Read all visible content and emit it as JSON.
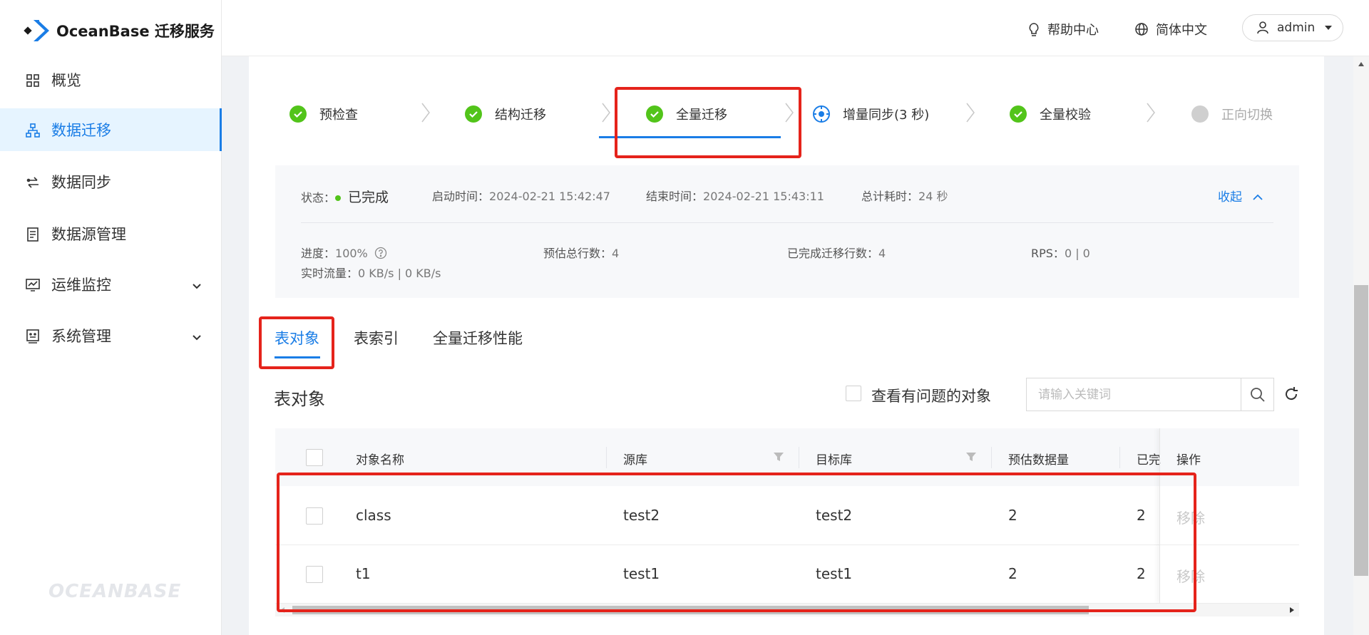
{
  "app": {
    "brand": "OceanBase 迁移服务",
    "footer_logo": "OCEANBASE"
  },
  "colors": {
    "accent": "#1a7de6",
    "success": "#52c41a",
    "highlight": "#e5231b"
  },
  "sidebar": {
    "items": [
      {
        "label": "概览",
        "icon": "grid-icon"
      },
      {
        "label": "数据迁移",
        "icon": "sitemap-icon",
        "active": true
      },
      {
        "label": "数据同步",
        "icon": "sync-icon"
      },
      {
        "label": "数据源管理",
        "icon": "database-icon"
      },
      {
        "label": "运维监控",
        "icon": "monitor-icon",
        "expandable": true
      },
      {
        "label": "系统管理",
        "icon": "system-icon",
        "expandable": true
      }
    ]
  },
  "topbar": {
    "help": "帮助中心",
    "language": "简体中文",
    "user": "admin"
  },
  "steps": [
    {
      "label": "预检查",
      "state": "done"
    },
    {
      "label": "结构迁移",
      "state": "done"
    },
    {
      "label": "全量迁移",
      "state": "done",
      "selected": true
    },
    {
      "label": "增量同步(3 秒)",
      "state": "running"
    },
    {
      "label": "全量校验",
      "state": "done"
    },
    {
      "label": "正向切换",
      "state": "pending"
    }
  ],
  "status": {
    "state_label": "状态：",
    "state_value": "已完成",
    "start_label": "启动时间：",
    "start_value": "2024-02-21 15:42:47",
    "end_label": "结束时间：",
    "end_value": "2024-02-21 15:43:11",
    "duration_label": "总计耗时：",
    "duration_value": "24 秒",
    "collapse": "收起",
    "progress_label": "进度：",
    "progress_value": "100%",
    "est_rows_label": "预估总行数：",
    "est_rows_value": "4",
    "done_rows_label": "已完成迁移行数：",
    "done_rows_value": "4",
    "rps_label": "RPS：",
    "rps_value": "0 | 0",
    "traffic_label": "实时流量：",
    "traffic_value": "0 KB/s | 0 KB/s"
  },
  "tabs": [
    "表对象",
    "表索引",
    "全量迁移性能"
  ],
  "section": {
    "title": "表对象",
    "issue_filter": "查看有问题的对象",
    "search_placeholder": "请输入关键词"
  },
  "table": {
    "headers": [
      "对象名称",
      "源库",
      "目标库",
      "预估数据量",
      "已完",
      "操作"
    ],
    "rows": [
      {
        "name": "class",
        "source": "test2",
        "target": "test2",
        "estimated": "2",
        "done": "2",
        "action": "移除"
      },
      {
        "name": "t1",
        "source": "test1",
        "target": "test1",
        "estimated": "2",
        "done": "2",
        "action": "移除"
      }
    ]
  }
}
